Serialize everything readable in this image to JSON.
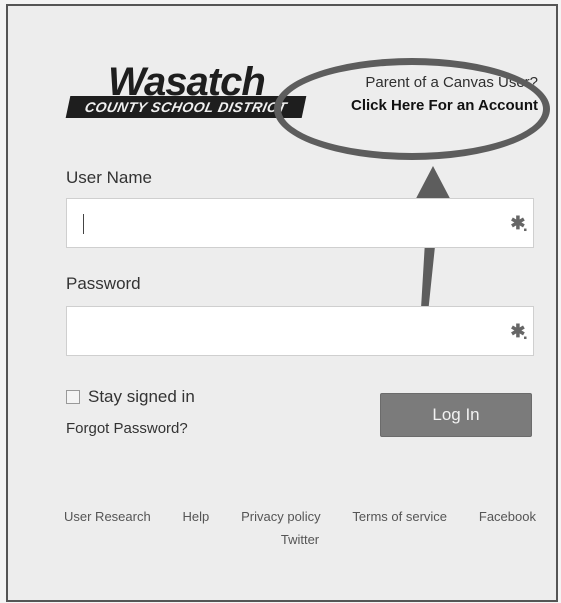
{
  "logo": {
    "word": "Wasatch",
    "bar": "COUNTY SCHOOL DISTRICT"
  },
  "parent_link": {
    "question": "Parent of a Canvas User?",
    "action": "Click Here For an Account"
  },
  "form": {
    "username_label": "User Name",
    "username_value": "",
    "password_label": "Password",
    "password_value": "",
    "stay_signed_in": "Stay signed in",
    "forgot_password": "Forgot Password?",
    "login_button": "Log In"
  },
  "footer": {
    "links": [
      "User Research",
      "Help",
      "Privacy policy",
      "Terms of service",
      "Facebook"
    ],
    "twitter": "Twitter"
  },
  "icons": {
    "field_key": "key-icon",
    "arrow": "arrow-up-icon",
    "oval": "highlight-oval"
  },
  "colors": {
    "button": "#7b7b7b",
    "annotation": "#5d5d5d",
    "background": "#ededed"
  }
}
